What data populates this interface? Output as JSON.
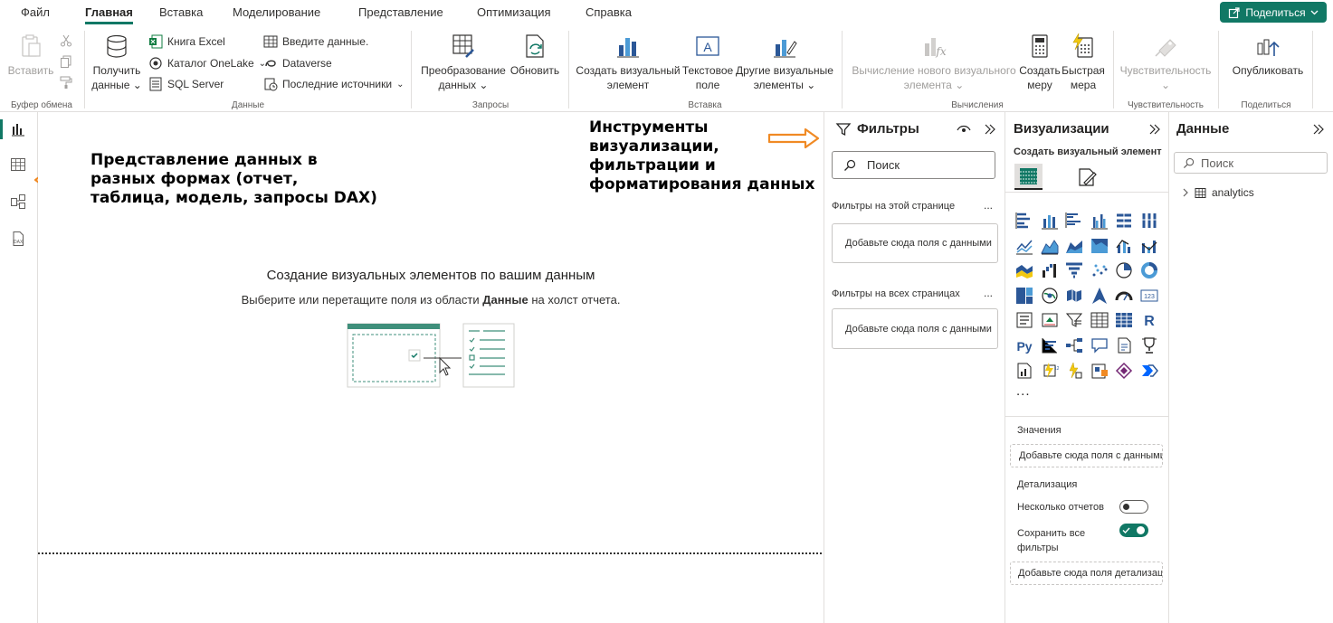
{
  "menu": {
    "tabs": [
      "Файл",
      "Главная",
      "Вставка",
      "Моделирование",
      "Представление",
      "Оптимизация",
      "Справка"
    ],
    "active": "Главная",
    "share_label": "Поделиться"
  },
  "ribbon": {
    "clipboard": {
      "paste": "Вставить",
      "group": "Буфер обмена"
    },
    "data": {
      "get_data_1": "Получить",
      "get_data_2": "данные",
      "excel": "Книга Excel",
      "onelake": "Каталог OneLake",
      "sql": "SQL Server",
      "enter_data": "Введите данные.",
      "dataverse": "Dataverse",
      "recent": "Последние источники",
      "group": "Данные"
    },
    "queries": {
      "transform_1": "Преобразование",
      "transform_2": "данных",
      "refresh": "Обновить",
      "group": "Запросы"
    },
    "insert": {
      "new_visual_1": "Создать визуальный",
      "new_visual_2": "элемент",
      "textbox_1": "Текстовое",
      "textbox_2": "поле",
      "more_visuals_1": "Другие визуальные",
      "more_visuals_2": "элементы",
      "group": "Вставка"
    },
    "calculations": {
      "new_calc_1": "Вычисление нового визуального",
      "new_calc_2": "элемента",
      "new_measure_1": "Создать",
      "new_measure_2": "меру",
      "quick_measure_1": "Быстрая",
      "quick_measure_2": "мера",
      "group": "Вычисления"
    },
    "sensitivity": {
      "label": "Чувствительность",
      "group": "Чувствительность"
    },
    "share": {
      "publish": "Опубликовать",
      "group": "Поделиться"
    }
  },
  "canvas": {
    "title": "Создание визуальных элементов по вашим данным",
    "subtitle_pre": "Выберите или перетащите поля из области ",
    "subtitle_bold": "Данные",
    "subtitle_post": " на холст отчета."
  },
  "annotations": {
    "left_1": "Представление данных в",
    "left_2": "разных формах (отчет,",
    "left_3": "таблица, модель, запросы DAX)",
    "right_1": "Инструменты",
    "right_2": "визуализации,",
    "right_3": "фильтрации и",
    "right_4": "форматирования данных",
    "arrow_color": "#f08a24"
  },
  "filters": {
    "title": "Фильтры",
    "search_placeholder": "Поиск",
    "page_section": "Фильтры на этой странице",
    "page_drop": "Добавьте сюда поля с данными",
    "all_section": "Фильтры на всех страницах",
    "all_drop": "Добавьте сюда поля с данными",
    "more": "..."
  },
  "viz": {
    "title": "Визуализации",
    "build_label": "Создать визуальный элемент",
    "more": "...",
    "values_label": "Значения",
    "values_drop": "Добавьте сюда поля с данными",
    "drill_label": "Детализация",
    "multi_reports": "Несколько отчетов",
    "keep_all_1": "Сохранить все",
    "keep_all_2": "фильтры",
    "drill_drop": "Добавьте сюда поля детализации",
    "multi_reports_on": false,
    "keep_all_on": true
  },
  "data_pane": {
    "title": "Данные",
    "search_placeholder": "Поиск",
    "tables": [
      "analytics"
    ]
  },
  "colors": {
    "accent": "#117865",
    "icon_blue": "#2b5797",
    "icon_light": "#4c9bd6"
  }
}
